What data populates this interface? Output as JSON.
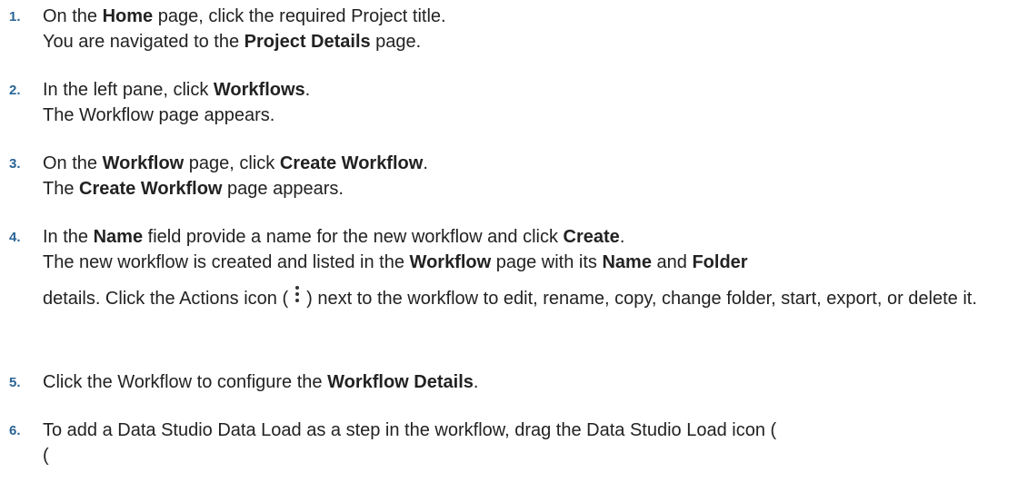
{
  "steps": [
    {
      "number": "1.",
      "l1a": "On the ",
      "l1b": "Home",
      "l1c": " page, click the required Project title.",
      "l2a": "You are navigated to the ",
      "l2b": "Project Details",
      "l2c": " page."
    },
    {
      "number": "2.",
      "l1a": "In the left pane, click ",
      "l1b": "Workflows",
      "l1c": ".",
      "l2": "The Workflow page appears."
    },
    {
      "number": "3.",
      "l1a": "On the ",
      "l1b": "Workflow",
      "l1c": " page, click ",
      "l1d": "Create Workflow",
      "l1e": ".",
      "l2a": "The ",
      "l2b": "Create Workflow",
      "l2c": " page appears."
    },
    {
      "number": "4.",
      "l1a": "In the ",
      "l1b": "Name",
      "l1c": " field provide a name for the new workflow and click ",
      "l1d": "Create",
      "l1e": ".",
      "l2a": "The new workflow is created and listed in the ",
      "l2b": "Workflow",
      "l2c": " page with its ",
      "l2d": "Name",
      "l2e": " and ",
      "l2f": "Folder",
      "l3a": "details. Click the Actions icon (",
      "l3b": ") next to the workflow to edit, rename, copy, change folder, start, export, or delete it.",
      "icon": "kebab-vertical-icon"
    },
    {
      "number": "5.",
      "l1a": "Click the Workflow to configure the ",
      "l1b": "Workflow Details",
      "l1c": "."
    },
    {
      "number": "6.",
      "l1": "To add a Data Studio Data Load as a step in the workflow, drag the Data Studio Load icon (",
      "l2": "("
    }
  ]
}
